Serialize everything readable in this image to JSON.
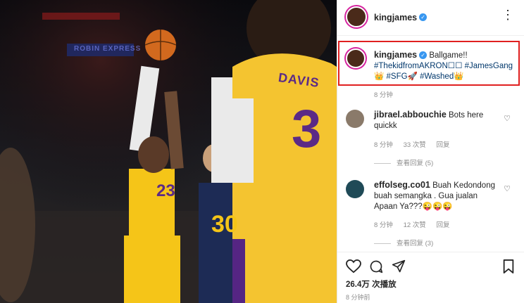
{
  "post": {
    "username": "kingjames",
    "caption_text": "Ballgame!!",
    "caption_tags_line1": "#ThekidfromAKRON☐☐ #JamesGang",
    "caption_tags_line2": "👑 #SFG🚀 #Washed👑",
    "time": "8 分钟",
    "views": "26.4万 次播放",
    "posted_ago": "8 分钟前"
  },
  "comments": [
    {
      "username": "jibrael.abbouchie",
      "text1": "Bots here",
      "text2": "quickk",
      "time": "8 分钟",
      "likes": "33 次赞",
      "reply": "回复",
      "view_replies": "查看回复 (5)"
    },
    {
      "username": "effolseg.co01",
      "text1": "Buah Kedondong",
      "text2": "buah semangka . Gua jualan",
      "text3": "Apaan Ya???😜😜😜",
      "time": "8 分钟",
      "likes": "12 次赞",
      "reply": "回复",
      "view_replies": "查看回复 (3)"
    }
  ],
  "video": {
    "player1_number": "3",
    "player1_name": "DAVIS",
    "player2_number": "23",
    "player3_number": "30",
    "arena_text": "ROBIN EXPRESS"
  },
  "icons": {
    "more": "more-icon",
    "heart": "heart-icon",
    "comment": "comment-icon",
    "share": "share-icon",
    "bookmark": "bookmark-icon"
  }
}
